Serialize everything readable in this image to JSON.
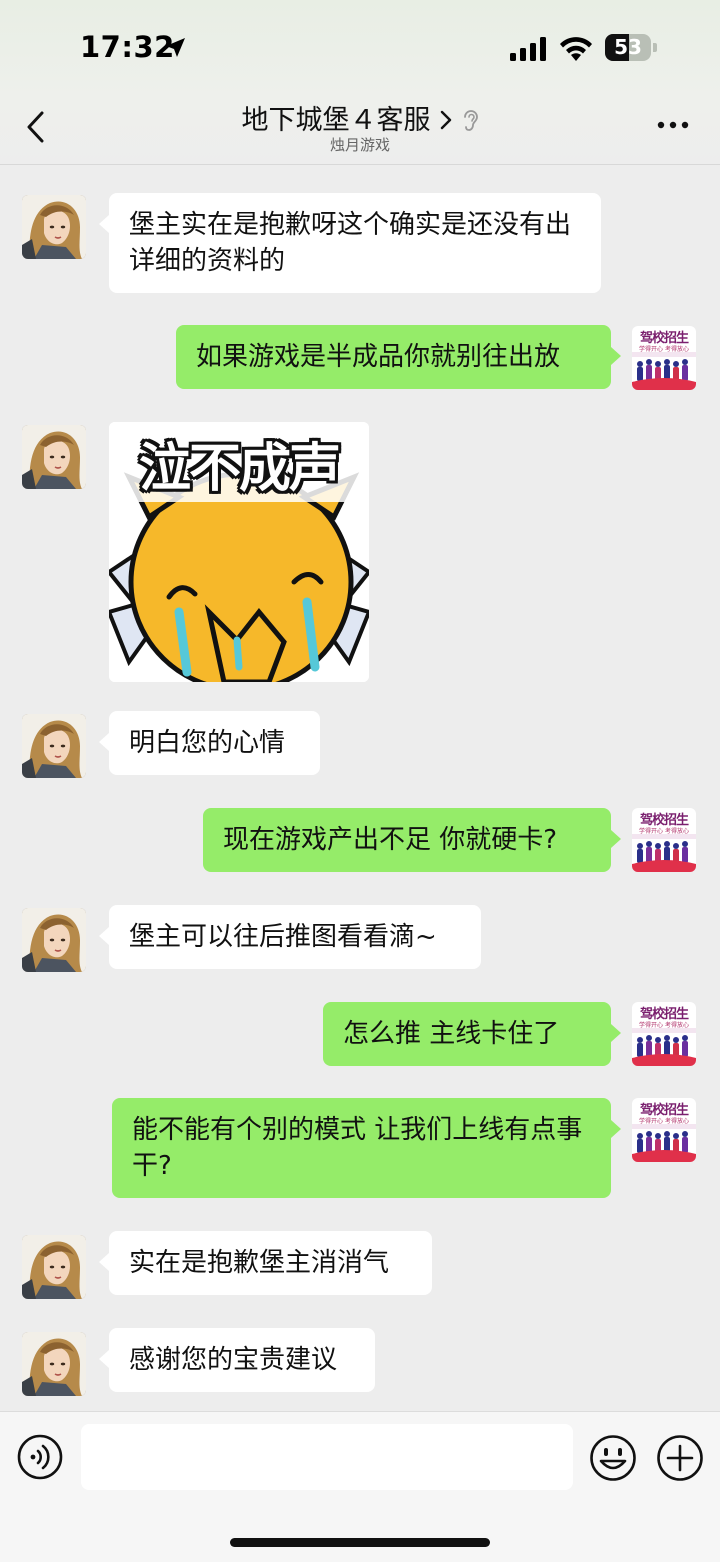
{
  "status_bar": {
    "time": "17:32",
    "battery_level": "53",
    "battery_fraction": 0.53
  },
  "header": {
    "title": "地下城堡４客服",
    "subtitle": "烛月游戏",
    "back_icon": "chevron-left-icon",
    "more_icon": "more-dots-icon"
  },
  "colors": {
    "bubble_out": "#95ec69",
    "bubble_in": "#ffffff",
    "background": "#ededed"
  },
  "messages": [
    {
      "sender": "agent",
      "type": "text",
      "text": "堡主实在是抱歉呀这个确实是还没有出详细的资料的"
    },
    {
      "sender": "me",
      "type": "text",
      "text": "如果游戏是半成品你就别往出放"
    },
    {
      "sender": "agent",
      "type": "sticker",
      "text": "泣不成声"
    },
    {
      "sender": "agent",
      "type": "text",
      "text": "明白您的心情"
    },
    {
      "sender": "me",
      "type": "text",
      "text": "现在游戏产出不足  你就硬卡?"
    },
    {
      "sender": "agent",
      "type": "text",
      "text": "堡主可以往后推图看看滴~"
    },
    {
      "sender": "me",
      "type": "text",
      "text": "怎么推 主线卡住了"
    },
    {
      "sender": "me",
      "type": "text",
      "text": "能不能有个别的模式 让我们上线有点事干?"
    },
    {
      "sender": "agent",
      "type": "text",
      "text": "实在是抱歉堡主消消气"
    },
    {
      "sender": "agent",
      "type": "text",
      "text": "感谢您的宝贵建议"
    }
  ],
  "my_avatar": {
    "logo_text": "驾校招生",
    "tagline": "学得开心 考得放心"
  },
  "input_bar": {
    "placeholder": "",
    "icons": [
      "voice-icon",
      "emoji-icon",
      "plus-icon"
    ]
  }
}
